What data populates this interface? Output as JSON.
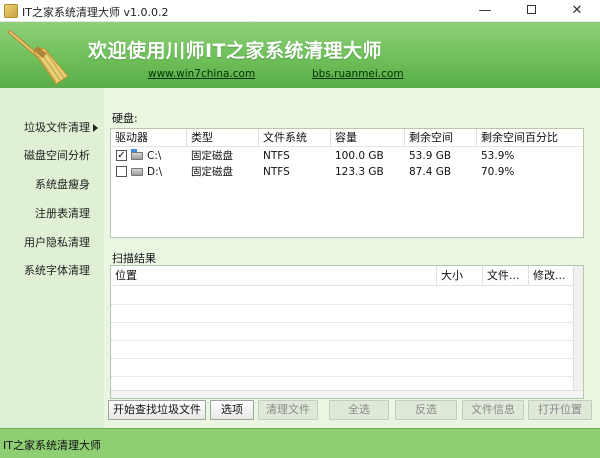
{
  "window": {
    "title": "IT之家系统清理大师 v1.0.0.2",
    "minimize_glyph": "—",
    "close_glyph": "✕"
  },
  "header": {
    "title": "欢迎使用川师IT之家系统清理大师",
    "link1": "www.win7china.com",
    "link2": "bbs.ruanmei.com",
    "logo_icon": "broom-icon"
  },
  "sidebar": {
    "items": [
      {
        "label": "垃圾文件清理",
        "active": true
      },
      {
        "label": "磁盘空间分析"
      },
      {
        "label": "系统盘瘦身"
      },
      {
        "label": "注册表清理"
      },
      {
        "label": "用户隐私清理"
      },
      {
        "label": "系统字体清理"
      }
    ]
  },
  "disks": {
    "label": "硬盘:",
    "columns": [
      "驱动器",
      "类型",
      "文件系统",
      "容量",
      "剩余空间",
      "剩余空间百分比"
    ],
    "rows": [
      {
        "checked": true,
        "drive": "C:\\",
        "type": "固定磁盘",
        "fs": "NTFS",
        "capacity": "100.0 GB",
        "free": "53.9 GB",
        "percent": "53.9%"
      },
      {
        "checked": false,
        "drive": "D:\\",
        "type": "固定磁盘",
        "fs": "NTFS",
        "capacity": "123.3 GB",
        "free": "87.4 GB",
        "percent": "70.9%"
      }
    ]
  },
  "results": {
    "label": "扫描结果",
    "columns": [
      "位置",
      "大小",
      "文件...",
      "修改..."
    ]
  },
  "buttons": {
    "scan": "开始查找垃圾文件",
    "options": "选项",
    "clean": "清理文件",
    "select_all": "全选",
    "invert": "反选",
    "file_info": "文件信息",
    "open_location": "打开位置"
  },
  "status": {
    "text": "IT之家系统清理大师"
  },
  "colors": {
    "header_green": "#6fbf5a",
    "sidebar_bg": "#dff0d5",
    "status_green": "#8fce73"
  }
}
